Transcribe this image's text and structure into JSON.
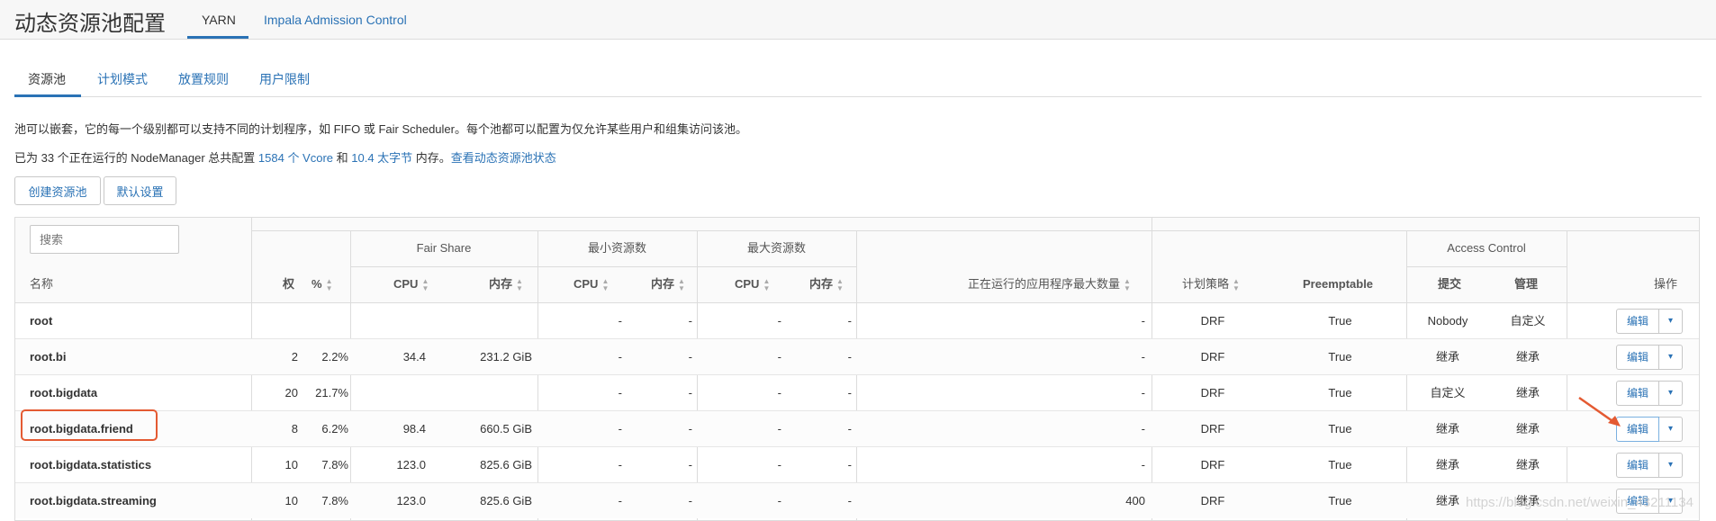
{
  "page": {
    "title": "动态资源池配置",
    "top_tabs": [
      "YARN",
      "Impala Admission Control"
    ],
    "sub_tabs": [
      "资源池",
      "计划模式",
      "放置规则",
      "用户限制"
    ]
  },
  "description": {
    "line1": "池可以嵌套，它的每一个级别都可以支持不同的计划程序，如 FIFO 或 Fair Scheduler。每个池都可以配置为仅允许某些用户和组集访问该池。",
    "line2_prefix": "已为 33 个正在运行的 NodeManager 总共配置 ",
    "line2_vcore": "1584 个 Vcore",
    "line2_and": " 和 ",
    "line2_mem": "10.4 太字节",
    "line2_suffix": " 内存。",
    "line2_link": "查看动态资源池状态"
  },
  "actions": {
    "create_pool": "创建资源池",
    "default_settings": "默认设置"
  },
  "table": {
    "search_placeholder": "搜索",
    "groups": {
      "fair_share": "Fair Share",
      "min_resources": "最小资源数",
      "max_resources": "最大资源数",
      "access_control": "Access Control"
    },
    "columns": {
      "name": "名称",
      "weight": "权",
      "percent": "%",
      "fs_cpu": "CPU",
      "fs_mem": "内存",
      "min_cpu": "CPU",
      "min_mem": "内存",
      "max_cpu": "CPU",
      "max_mem": "内存",
      "max_apps": "正在运行的应用程序最大数量",
      "policy": "计划策略",
      "preemptable": "Preemptable",
      "submit": "提交",
      "admin": "管理",
      "actions": "操作"
    },
    "edit_label": "编辑",
    "dropdown_glyph": "▾",
    "rows": [
      {
        "name": "root",
        "weight": "",
        "percent": "",
        "fs_cpu": "",
        "fs_mem": "",
        "min_cpu": "-",
        "min_mem": "-",
        "max_cpu": "-",
        "max_mem": "-",
        "max_apps": "-",
        "policy": "DRF",
        "preemptable": "True",
        "submit": "Nobody",
        "admin": "自定义"
      },
      {
        "name": "root.bi",
        "weight": "2",
        "percent": "2.2%",
        "fs_cpu": "34.4",
        "fs_mem": "231.2 GiB",
        "min_cpu": "-",
        "min_mem": "-",
        "max_cpu": "-",
        "max_mem": "-",
        "max_apps": "-",
        "policy": "DRF",
        "preemptable": "True",
        "submit": "继承",
        "admin": "继承"
      },
      {
        "name": "root.bigdata",
        "weight": "20",
        "percent": "21.7%",
        "fs_cpu": "",
        "fs_mem": "",
        "min_cpu": "-",
        "min_mem": "-",
        "max_cpu": "-",
        "max_mem": "-",
        "max_apps": "-",
        "policy": "DRF",
        "preemptable": "True",
        "submit": "自定义",
        "admin": "继承"
      },
      {
        "name": "root.bigdata.friend",
        "weight": "8",
        "percent": "6.2%",
        "fs_cpu": "98.4",
        "fs_mem": "660.5 GiB",
        "min_cpu": "-",
        "min_mem": "-",
        "max_cpu": "-",
        "max_mem": "-",
        "max_apps": "-",
        "policy": "DRF",
        "preemptable": "True",
        "submit": "继承",
        "admin": "继承"
      },
      {
        "name": "root.bigdata.statistics",
        "weight": "10",
        "percent": "7.8%",
        "fs_cpu": "123.0",
        "fs_mem": "825.6 GiB",
        "min_cpu": "-",
        "min_mem": "-",
        "max_cpu": "-",
        "max_mem": "-",
        "max_apps": "-",
        "policy": "DRF",
        "preemptable": "True",
        "submit": "继承",
        "admin": "继承"
      },
      {
        "name": "root.bigdata.streaming",
        "weight": "10",
        "percent": "7.8%",
        "fs_cpu": "123.0",
        "fs_mem": "825.6 GiB",
        "min_cpu": "-",
        "min_mem": "-",
        "max_cpu": "-",
        "max_mem": "-",
        "max_apps": "400",
        "policy": "DRF",
        "preemptable": "True",
        "submit": "继承",
        "admin": "继承"
      }
    ]
  },
  "watermark": "https://blog.csdn.net/weixin_43211134",
  "colors": {
    "link": "#2a72b5",
    "highlight": "#e45a32",
    "border": "#dcdcdc"
  }
}
